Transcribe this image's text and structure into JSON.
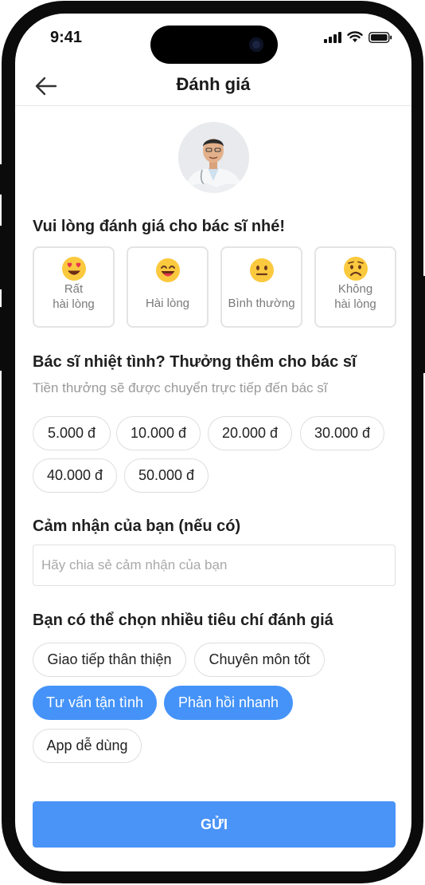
{
  "status": {
    "time": "9:41"
  },
  "header": {
    "title": "Đánh giá"
  },
  "rating": {
    "heading": "Vui lòng đánh giá cho bác sĩ nhé!",
    "options": [
      {
        "label": "Rất\nhài lòng",
        "icon": "heart-eyes-emoji"
      },
      {
        "label": "Hài lòng",
        "icon": "grinning-emoji"
      },
      {
        "label": "Bình thường",
        "icon": "neutral-emoji"
      },
      {
        "label": "Không\nhài lòng",
        "icon": "sad-emoji"
      }
    ]
  },
  "tip": {
    "heading": "Bác sĩ nhiệt tình? Thưởng thêm cho bác sĩ",
    "subtitle": "Tiền thưởng sẽ được chuyển trực tiếp đến bác sĩ",
    "amounts": [
      "5.000 đ",
      "10.000 đ",
      "20.000 đ",
      "30.000 đ",
      "40.000 đ",
      "50.000 đ"
    ]
  },
  "feedback": {
    "heading": "Cảm nhận của bạn (nếu có)",
    "placeholder": "Hãy chia sẻ cảm nhận của bạn",
    "value": ""
  },
  "criteria": {
    "heading": "Bạn có thể chọn nhiều tiêu chí đánh giá",
    "items": [
      {
        "label": "Giao tiếp thân thiện",
        "selected": false
      },
      {
        "label": "Chuyên môn tốt",
        "selected": false
      },
      {
        "label": "Tư vấn tận tình",
        "selected": true
      },
      {
        "label": "Phản hồi nhanh",
        "selected": true
      },
      {
        "label": "App dễ dùng",
        "selected": false
      }
    ]
  },
  "submit": {
    "label": "GỬI"
  },
  "colors": {
    "accent": "#4593f8",
    "border": "#e4e4e4",
    "muted": "#9a9a9a"
  }
}
